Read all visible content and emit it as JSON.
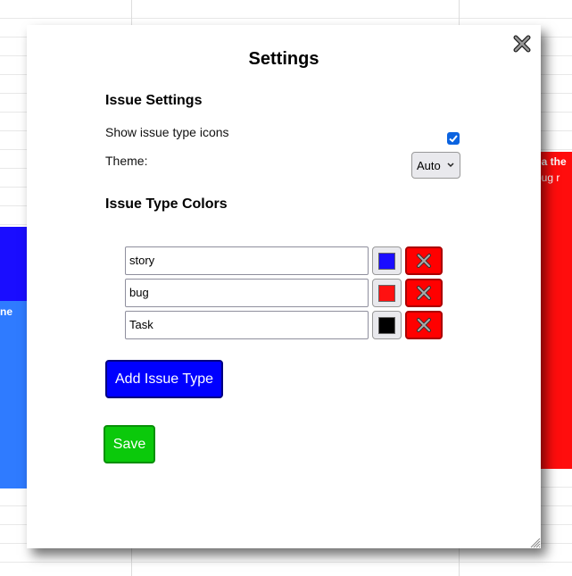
{
  "background": {
    "left_card_top_color": "#1a0dff",
    "left_card_bottom_color": "#2f7bff",
    "left_card_text": "ne",
    "right_card_color": "#ff0d0d",
    "right_card_line1": "hoa the",
    "right_card_line2": "g bug r"
  },
  "dialog": {
    "title": "Settings",
    "close_icon": "close-x-icon",
    "issue_settings": {
      "heading": "Issue Settings",
      "show_icons_label": "Show issue type icons",
      "show_icons_checked": true,
      "theme_label": "Theme:",
      "theme_value": "Auto"
    },
    "issue_type_colors": {
      "heading": "Issue Type Colors",
      "types": [
        {
          "name": "story",
          "color": "#1a0dff"
        },
        {
          "name": "bug",
          "color": "#ff1111"
        },
        {
          "name": "Task",
          "color": "#000000"
        }
      ]
    },
    "add_button": "Add Issue Type",
    "save_button": "Save"
  }
}
